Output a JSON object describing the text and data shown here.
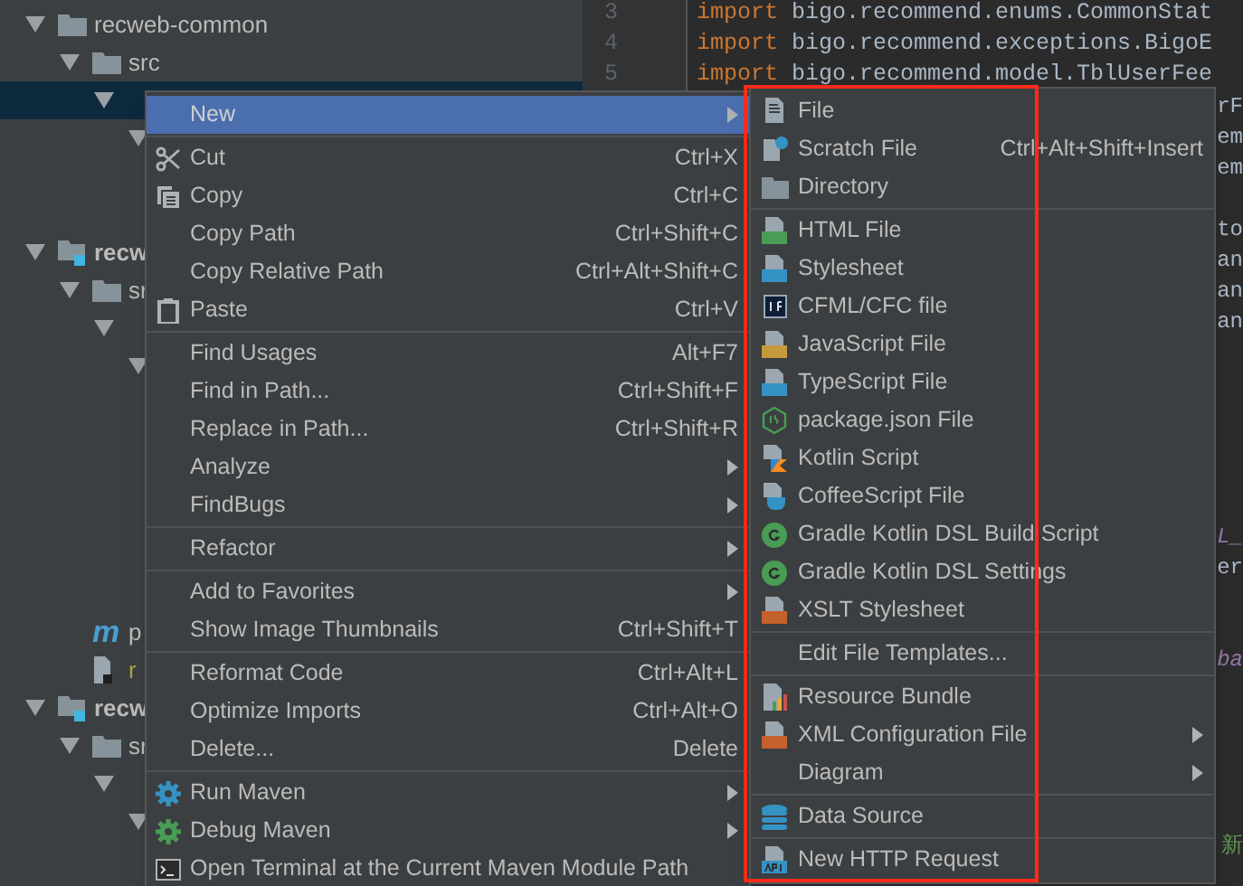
{
  "tree": [
    {
      "label": "recweb-common",
      "kind": "folder",
      "expanded": true,
      "selected": false,
      "children": [
        {
          "label": "src",
          "kind": "folder",
          "expanded": true,
          "selected": false,
          "children": [
            {
              "expanded": true,
              "selected": true,
              "children": [
                {
                  "expanded": true,
                  "selected": false,
                  "children": [
                    {
                      "selected": false
                    },
                    {
                      "selected": false
                    }
                  ]
                }
              ]
            }
          ]
        }
      ]
    },
    {
      "label": "recw",
      "kind": "module",
      "expanded": true,
      "selected": false,
      "children": [
        {
          "label": "sr",
          "kind": "folder",
          "expanded": true,
          "selected": false,
          "children": [
            {
              "expanded": true,
              "selected": false,
              "children": [
                {
                  "expanded": true,
                  "selected": false,
                  "children": [
                    {
                      "selected": false
                    },
                    {
                      "selected": false
                    },
                    {
                      "selected": false
                    },
                    {
                      "selected": false
                    },
                    {
                      "selected": false
                    },
                    {
                      "selected": false
                    }
                  ]
                }
              ]
            }
          ]
        },
        {
          "label": "p",
          "kind": "maven",
          "glyph": "m",
          "selected": false
        },
        {
          "label": "r",
          "kind": "file",
          "color": "#a8a83c",
          "selected": false
        }
      ]
    },
    {
      "label": "recw",
      "kind": "module",
      "expanded": true,
      "selected": false,
      "children": [
        {
          "label": "sr",
          "kind": "folder",
          "expanded": true,
          "selected": false,
          "children": [
            {
              "expanded": true,
              "selected": false,
              "children": [
                {
                  "expanded": true,
                  "selected": false
                }
              ]
            }
          ]
        }
      ]
    }
  ],
  "editor": {
    "lines": [
      {
        "kind": "code",
        "number": "3",
        "keyword": "import",
        "code": " bigo.recommend.enums.CommonStat"
      },
      {
        "kind": "code",
        "number": "4",
        "keyword": "import",
        "code": " bigo.recommend.exceptions.BigoE"
      },
      {
        "kind": "code",
        "number": "5",
        "keyword": "import",
        "code": " bigo.recommend.model.TblUserFee"
      },
      {
        "kind": "plain",
        "tail": "rF"
      },
      {
        "kind": "plain",
        "tail": "em"
      },
      {
        "kind": "plain",
        "tail": "em"
      },
      {
        "kind": "blank"
      },
      {
        "kind": "plain",
        "tail": "to"
      },
      {
        "kind": "plain",
        "tail": "an"
      },
      {
        "kind": "plain",
        "tail": "an"
      },
      {
        "kind": "plain",
        "tail": "an"
      },
      {
        "kind": "blank"
      },
      {
        "kind": "blank"
      },
      {
        "kind": "blank"
      },
      {
        "kind": "blank"
      },
      {
        "kind": "blank"
      },
      {
        "kind": "blank"
      },
      {
        "kind": "field",
        "tail": "L_"
      },
      {
        "kind": "plain",
        "tail": "er"
      },
      {
        "kind": "blank"
      },
      {
        "kind": "blank"
      },
      {
        "kind": "field",
        "tail": "ba"
      },
      {
        "kind": "blank"
      },
      {
        "kind": "blank"
      },
      {
        "kind": "blank"
      },
      {
        "kind": "blank"
      },
      {
        "kind": "blank"
      },
      {
        "kind": "comment",
        "tail": "新"
      }
    ]
  },
  "context_menu": {
    "items": [
      {
        "kind": "plain",
        "label": "New",
        "submenu": true,
        "selected": true
      },
      {
        "kind": "separator"
      },
      {
        "kind": "cut",
        "label": "Cut",
        "shortcut": "Ctrl+X",
        "selected": false
      },
      {
        "kind": "copy",
        "label": "Copy",
        "shortcut": "Ctrl+C",
        "selected": false
      },
      {
        "kind": "plain",
        "label": "Copy Path",
        "shortcut": "Ctrl+Shift+C",
        "selected": false
      },
      {
        "kind": "plain",
        "label": "Copy Relative Path",
        "shortcut": "Ctrl+Alt+Shift+C",
        "selected": false
      },
      {
        "kind": "paste",
        "label": "Paste",
        "shortcut": "Ctrl+V",
        "selected": false
      },
      {
        "kind": "separator"
      },
      {
        "kind": "plain",
        "label": "Find Usages",
        "shortcut": "Alt+F7",
        "selected": false
      },
      {
        "kind": "plain",
        "label": "Find in Path...",
        "shortcut": "Ctrl+Shift+F",
        "selected": false
      },
      {
        "kind": "plain",
        "label": "Replace in Path...",
        "shortcut": "Ctrl+Shift+R",
        "selected": false
      },
      {
        "kind": "plain",
        "label": "Analyze",
        "submenu": true,
        "selected": false
      },
      {
        "kind": "plain",
        "label": "FindBugs",
        "submenu": true,
        "selected": false
      },
      {
        "kind": "separator"
      },
      {
        "kind": "plain",
        "label": "Refactor",
        "submenu": true,
        "selected": false
      },
      {
        "kind": "separator"
      },
      {
        "kind": "plain",
        "label": "Add to Favorites",
        "submenu": true,
        "selected": false
      },
      {
        "kind": "plain",
        "label": "Show Image Thumbnails",
        "shortcut": "Ctrl+Shift+T",
        "selected": false
      },
      {
        "kind": "separator"
      },
      {
        "kind": "plain",
        "label": "Reformat Code",
        "shortcut": "Ctrl+Alt+L",
        "selected": false
      },
      {
        "kind": "plain",
        "label": "Optimize Imports",
        "shortcut": "Ctrl+Alt+O",
        "selected": false
      },
      {
        "kind": "plain",
        "label": "Delete...",
        "shortcut": "Delete",
        "selected": false
      },
      {
        "kind": "separator"
      },
      {
        "kind": "run-maven",
        "label": "Run Maven",
        "submenu": true,
        "selected": false
      },
      {
        "kind": "debug-maven",
        "label": "Debug Maven",
        "submenu": true,
        "selected": false
      },
      {
        "kind": "terminal",
        "label": "Open Terminal at the Current Maven Module Path",
        "selected": false
      }
    ]
  },
  "new_submenu": {
    "items": [
      {
        "kind": "file",
        "label": "File",
        "selected": false
      },
      {
        "kind": "scratch",
        "label": "Scratch File",
        "shortcut": "Ctrl+Alt+Shift+Insert",
        "selected": false
      },
      {
        "kind": "folder",
        "label": "Directory",
        "selected": false
      },
      {
        "kind": "separator"
      },
      {
        "kind": "html",
        "label": "HTML File",
        "selected": false
      },
      {
        "kind": "css",
        "label": "Stylesheet",
        "selected": false
      },
      {
        "kind": "cfml",
        "label": "CFML/CFC file",
        "selected": false
      },
      {
        "kind": "js",
        "label": "JavaScript File",
        "selected": false
      },
      {
        "kind": "ts",
        "label": "TypeScript File",
        "selected": false
      },
      {
        "kind": "nodejs",
        "label": "package.json File",
        "selected": false
      },
      {
        "kind": "kotlin",
        "label": "Kotlin Script",
        "selected": false
      },
      {
        "kind": "coffee",
        "label": "CoffeeScript File",
        "selected": false
      },
      {
        "kind": "gradle",
        "label": "Gradle Kotlin DSL Build Script",
        "selected": false
      },
      {
        "kind": "gradle",
        "label": "Gradle Kotlin DSL Settings",
        "selected": false
      },
      {
        "kind": "xml",
        "label": "XSLT Stylesheet",
        "selected": false
      },
      {
        "kind": "separator"
      },
      {
        "kind": "plain",
        "label": "Edit File Templates...",
        "selected": false
      },
      {
        "kind": "separator"
      },
      {
        "kind": "bundle",
        "label": "Resource Bundle",
        "selected": false
      },
      {
        "kind": "xml",
        "label": "XML Configuration File",
        "submenu": true,
        "selected": false
      },
      {
        "kind": "plain",
        "label": "Diagram",
        "submenu": true,
        "selected": false
      },
      {
        "kind": "separator"
      },
      {
        "kind": "database",
        "label": "Data Source",
        "selected": false
      },
      {
        "kind": "separator"
      },
      {
        "kind": "http",
        "label": "New HTTP Request",
        "selected": false
      }
    ]
  }
}
